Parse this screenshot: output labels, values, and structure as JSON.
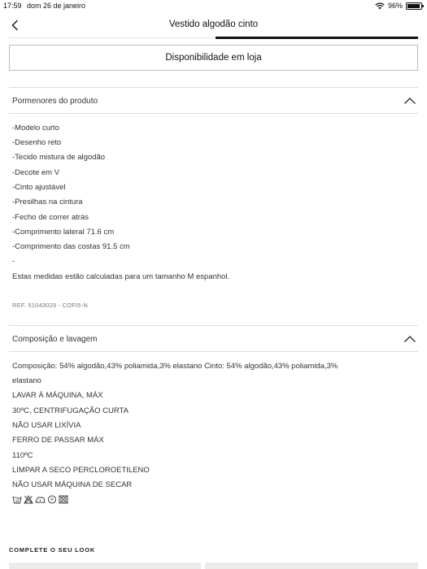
{
  "status_bar": {
    "time": "17:59",
    "date": "dom 26 de janeiro",
    "battery_text": "96%",
    "battery_level": 0.96
  },
  "nav": {
    "title": "Vestido algodão cinto"
  },
  "availability_button": "Disponibilidade em loja",
  "product_details": {
    "title": "Pormenores do produto",
    "lines": [
      "-Modelo curto",
      "-Desenho reto",
      "-Tecido mistura de algodão",
      "-Decote em V",
      "-Cinto ajustável",
      "-Presilhas na cintura",
      "-Fecho de correr atrás",
      "-Comprimento lateral 71.6 cm",
      "-Comprimento das costas 91.5 cm",
      "-",
      "Estas medidas estão calculadas para um tamanho M espanhol."
    ],
    "ref": "REF. 51043029 - COFI5-N"
  },
  "composition": {
    "title": "Composição e lavagem",
    "lines": [
      "Composição: 54%  algodão,43%  poliamida,3%  elastano Cinto: 54%  algodão,43%  poliamida,3%",
      "elastano",
      "LAVAR À MÁQUINA, MÁX",
      "30ºC, CENTRIFUGAÇÃO CURTA",
      "NÃO USAR LIXÍVIA",
      "FERRO DE PASSAR MÁX",
      "110ºC",
      "LIMPAR A SECO PERCLOROETILENO",
      "NÃO USAR MÁQUINA DE SECAR"
    ],
    "care_icons": [
      "wash-30-icon",
      "no-bleach-icon",
      "iron-icon",
      "dry-clean-p-icon",
      "no-tumble-dry-icon"
    ]
  },
  "complete_look": {
    "title": "COMPLETE O SEU LOOK"
  }
}
